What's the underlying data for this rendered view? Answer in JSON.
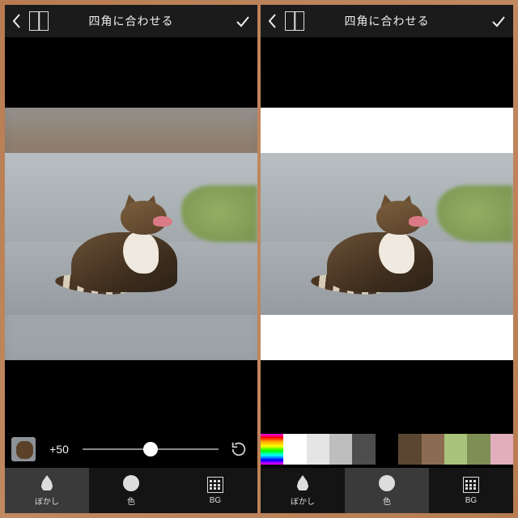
{
  "left": {
    "title": "四角に合わせる",
    "slider": {
      "value_label": "+50",
      "position_pct": 50
    },
    "tools": {
      "blur": {
        "label": "ぼかし",
        "active": true
      },
      "color": {
        "label": "色",
        "active": false
      },
      "bg": {
        "label": "BG",
        "active": false
      }
    }
  },
  "right": {
    "title": "四角に合わせる",
    "selected_color": "#ffffff",
    "swatches": [
      {
        "color": "gradient",
        "name": "color-picker"
      },
      {
        "color": "#ffffff",
        "name": "white",
        "active": true
      },
      {
        "color": "#e5e5e5",
        "name": "light-gray-1"
      },
      {
        "color": "#bdbdbd",
        "name": "light-gray-2"
      },
      {
        "color": "#4d4d4d",
        "name": "dark-gray"
      },
      {
        "color": "#000000",
        "name": "black"
      },
      {
        "color": "#5b4631",
        "name": "brown-dark"
      },
      {
        "color": "#8b6b51",
        "name": "brown"
      },
      {
        "color": "#a9c47a",
        "name": "green-light"
      },
      {
        "color": "#7e8f55",
        "name": "olive"
      },
      {
        "color": "#e2aebb",
        "name": "pink"
      }
    ],
    "tools": {
      "blur": {
        "label": "ぼかし",
        "active": false
      },
      "color": {
        "label": "色",
        "active": true
      },
      "bg": {
        "label": "BG",
        "active": false
      }
    }
  }
}
